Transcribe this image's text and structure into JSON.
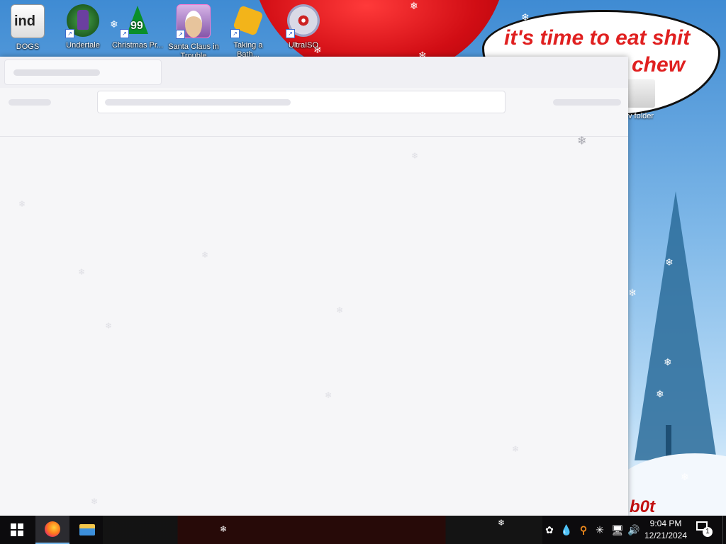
{
  "wallpaper": {
    "speech_line1": "it's time to eat shit",
    "speech_line2": "chew",
    "signature": "b0t",
    "desktop_icon_new_folder": "v folder"
  },
  "desktop": {
    "icons": [
      {
        "label": "DOGS",
        "icon": "document-icon"
      },
      {
        "label": "Undertale",
        "icon": "undertale-icon"
      },
      {
        "label": "Christmas Pr...",
        "icon": "christmas-tree-icon",
        "badge": "99"
      },
      {
        "label": "Santa Claus in Trouble",
        "icon": "santa-icon"
      },
      {
        "label": "Taking a Bath...",
        "icon": "bath-game-icon"
      },
      {
        "label": "UltraISO",
        "icon": "ultraiso-disc-icon"
      }
    ]
  },
  "window": {
    "state": "loading",
    "tab_title": "",
    "url": ""
  },
  "taskbar": {
    "apps": [
      {
        "name": "Firefox",
        "icon": "firefox-icon",
        "active": true
      },
      {
        "name": "File Explorer",
        "icon": "folder-icon",
        "active": false
      }
    ],
    "tray": {
      "icons": [
        "color-app-icon",
        "droplet-icon",
        "search-orange-icon",
        "snowflake-icon",
        "network-icon",
        "volume-icon"
      ]
    },
    "time": "9:04 PM",
    "date": "12/21/2024",
    "notification_count": "1"
  },
  "colors": {
    "taskbar": "#0c0b0d",
    "speech_text": "#e02020",
    "window_bg": "#f6f6f8",
    "active_indicator": "#76b9ed"
  }
}
